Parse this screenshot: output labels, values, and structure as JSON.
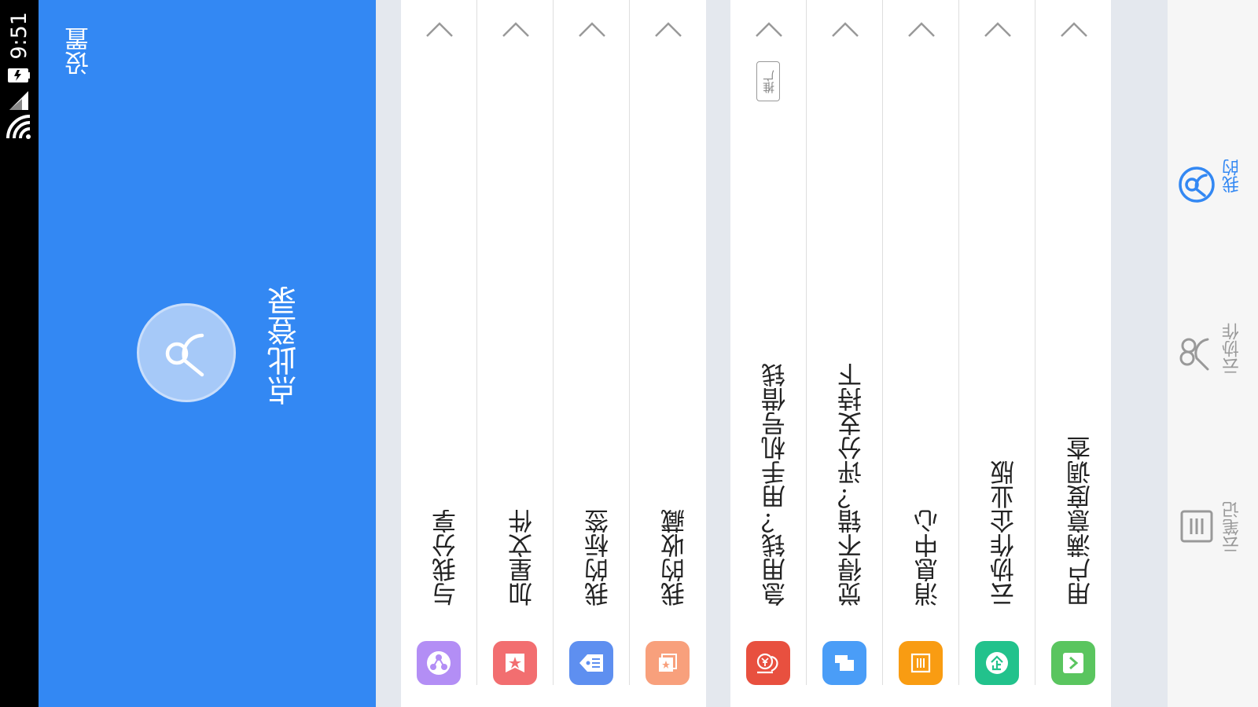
{
  "status_bar": {
    "time": "9:51"
  },
  "header": {
    "settings_label": "设置",
    "login_label": "点此登录"
  },
  "menu_group_1": [
    {
      "label": "与我分享",
      "icon": "share-icon",
      "color": "#b38ef5"
    },
    {
      "label": "加星文件",
      "icon": "star-file-icon",
      "color": "#f26e70"
    },
    {
      "label": "我的标签",
      "icon": "tag-icon",
      "color": "#5e8ff0"
    },
    {
      "label": "我的收藏",
      "icon": "favorite-icon",
      "color": "#f8a07c"
    }
  ],
  "menu_group_2": [
    {
      "label": "急用钱？用手机号借钱",
      "icon": "money-hand-icon",
      "color": "#e8503f",
      "badge": "推广"
    },
    {
      "label": "觉得不错？评分支持下",
      "icon": "thumbs-up-icon",
      "color": "#4a9df7"
    },
    {
      "label": "消息中心",
      "icon": "message-icon",
      "color": "#f99c12"
    },
    {
      "label": "云协作企业版",
      "icon": "enterprise-icon",
      "color": "#22c28c"
    },
    {
      "label": "用户满意度调查",
      "icon": "survey-icon",
      "color": "#5ac55f"
    }
  ],
  "nav": [
    {
      "label": "我的",
      "icon": "profile-icon",
      "active": true
    },
    {
      "label": "云协作",
      "icon": "collaboration-icon",
      "active": false
    },
    {
      "label": "云笔记",
      "icon": "notes-icon",
      "active": false
    }
  ],
  "colors": {
    "header_bg": "#3388f3",
    "nav_active": "#3388f3",
    "nav_inactive": "#9a9a9a"
  }
}
